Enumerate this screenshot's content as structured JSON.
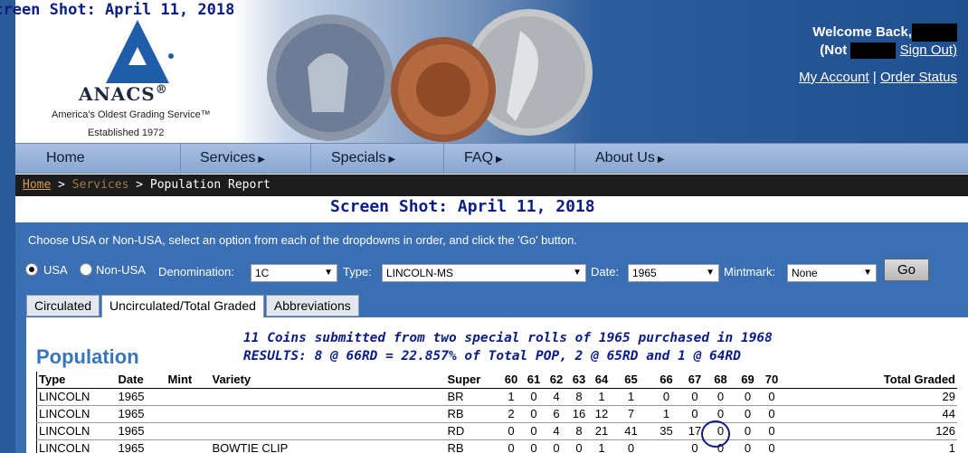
{
  "stamp": "Screen Shot: April 11, 2018",
  "logo": {
    "name": "ANACS",
    "registered": "®",
    "tagline": "America's Oldest Grading Service™",
    "established": "Established 1972"
  },
  "user": {
    "welcome": "Welcome Back,",
    "not_prefix": "(Not",
    "sign_out": "Sign Out)"
  },
  "account_links": {
    "my_account": "My Account",
    "separator": "|",
    "order_status": "Order Status"
  },
  "nav": {
    "items": [
      {
        "label": "Home",
        "arrow": ""
      },
      {
        "label": "Services",
        "arrow": "▶"
      },
      {
        "label": "Specials",
        "arrow": "▶"
      },
      {
        "label": "FAQ",
        "arrow": "▶"
      },
      {
        "label": "About Us",
        "arrow": "▶"
      }
    ]
  },
  "breadcrumb": {
    "home": "Home",
    "sep": ">",
    "services": "Services",
    "current": "Population Report"
  },
  "instructions": "Choose USA or Non-USA, select an option from each of the dropdowns in order, and click the 'Go' button.",
  "controls": {
    "usa": "USA",
    "non_usa": "Non-USA",
    "denomination_label": "Denomination:",
    "denomination_value": "1C",
    "type_label": "Type:",
    "type_value": "LINCOLN-MS",
    "date_label": "Date:",
    "date_value": "1965",
    "mintmark_label": "Mintmark:",
    "mintmark_value": "None",
    "go": "Go",
    "selected_country": "USA"
  },
  "tabs": [
    {
      "label": "Circulated",
      "active": false
    },
    {
      "label": "Uncirculated/Total Graded",
      "active": true
    },
    {
      "label": "Abbreviations",
      "active": false
    }
  ],
  "population": {
    "heading": "Population",
    "note_1": "11 Coins submitted from two special rolls of 1965 purchased in 1968",
    "note_2": "RESULTS: 8 @ 66RD = 22.857% of  Total POP, 2 @ 65RD and 1 @ 64RD",
    "headers": {
      "type": "Type",
      "date": "Date",
      "mint": "Mint",
      "variety": "Variety",
      "super": "Super",
      "g60": "60",
      "g61": "61",
      "g62": "62",
      "g63": "63",
      "g64": "64",
      "g65": "65",
      "g66": "66",
      "g67": "67",
      "g68": "68",
      "g69": "69",
      "g70": "70",
      "total": "Total Graded"
    },
    "rows": [
      {
        "type": "LINCOLN",
        "date": "1965",
        "mint": "",
        "variety": "",
        "super": "BR",
        "g": [
          "1",
          "0",
          "4",
          "8",
          "1",
          "1",
          "0",
          "0",
          "0",
          "0",
          "0"
        ],
        "total": "29"
      },
      {
        "type": "LINCOLN",
        "date": "1965",
        "mint": "",
        "variety": "",
        "super": "RB",
        "g": [
          "2",
          "0",
          "6",
          "16",
          "12",
          "7",
          "1",
          "0",
          "0",
          "0",
          "0"
        ],
        "total": "44"
      },
      {
        "type": "LINCOLN",
        "date": "1965",
        "mint": "",
        "variety": "",
        "super": "RD",
        "g": [
          "0",
          "0",
          "4",
          "8",
          "21",
          "41",
          "35",
          "17",
          "0",
          "0",
          "0"
        ],
        "total": "126"
      },
      {
        "type": "LINCOLN",
        "date": "1965",
        "mint": "",
        "variety": "BOWTIE CLIP",
        "super": "RB",
        "g": [
          "0",
          "0",
          "0",
          "0",
          "1",
          "0",
          "",
          "0",
          "0",
          "0",
          "0"
        ],
        "total": "1"
      }
    ]
  },
  "colors": {
    "accent_blue": "#3b6fb3",
    "heading_blue": "#3776b8",
    "stamp_navy": "#0b1d84",
    "nav_bg": "#9bb4da"
  }
}
